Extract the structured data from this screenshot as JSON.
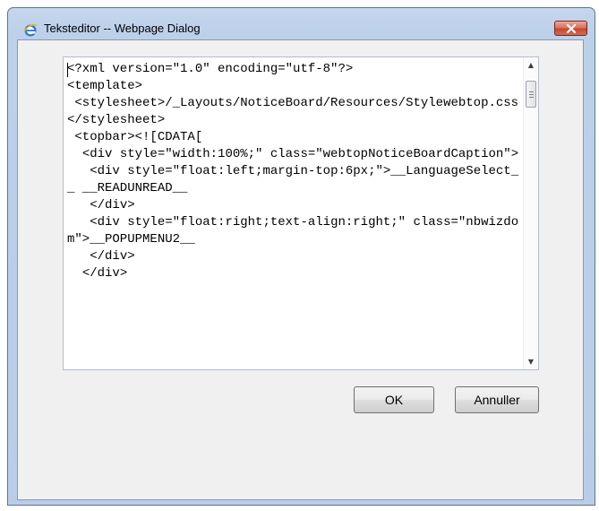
{
  "window": {
    "title": "Teksteditor -- Webpage Dialog"
  },
  "editor": {
    "content": "<?xml version=\"1.0\" encoding=\"utf-8\"?>\n<template>\n <stylesheet>/_Layouts/NoticeBoard/Resources/Stylewebtop.css</stylesheet>\n <topbar><![CDATA[\n  <div style=\"width:100%;\" class=\"webtopNoticeBoardCaption\">\n   <div style=\"float:left;margin-top:6px;\">__LanguageSelect__ __READUNREAD__\n   </div>\n   <div style=\"float:right;text-align:right;\" class=\"nbwizdom\">__POPUPMENU2__\n   </div>\n  </div>"
  },
  "buttons": {
    "ok": "OK",
    "cancel": "Annuller"
  },
  "icons": {
    "title_icon": "internet-explorer-icon",
    "close": "close-icon"
  },
  "colors": {
    "frame": "#b9cde8",
    "close_button": "#c8462f",
    "client_background": "#f0f0f0"
  }
}
